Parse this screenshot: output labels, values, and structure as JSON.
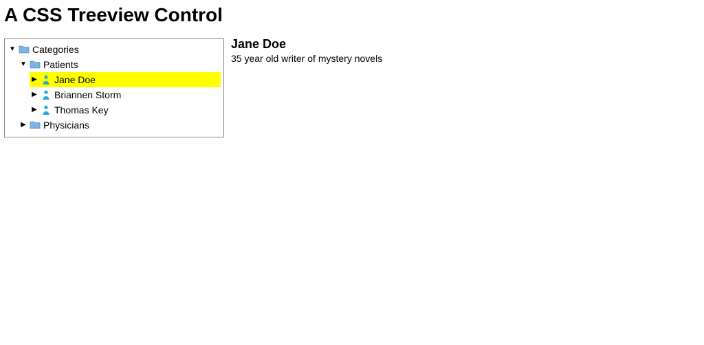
{
  "page": {
    "title": "A CSS Treeview Control"
  },
  "tree": {
    "root": {
      "label": "Categories",
      "children": {
        "patients": {
          "label": "Patients",
          "items": [
            {
              "label": "Jane Doe"
            },
            {
              "label": "Briannen Storm"
            },
            {
              "label": "Thomas Key"
            }
          ]
        },
        "physicians": {
          "label": "Physicians"
        }
      }
    }
  },
  "detail": {
    "name": "Jane Doe",
    "summary": "35 year old writer of mystery novels"
  }
}
